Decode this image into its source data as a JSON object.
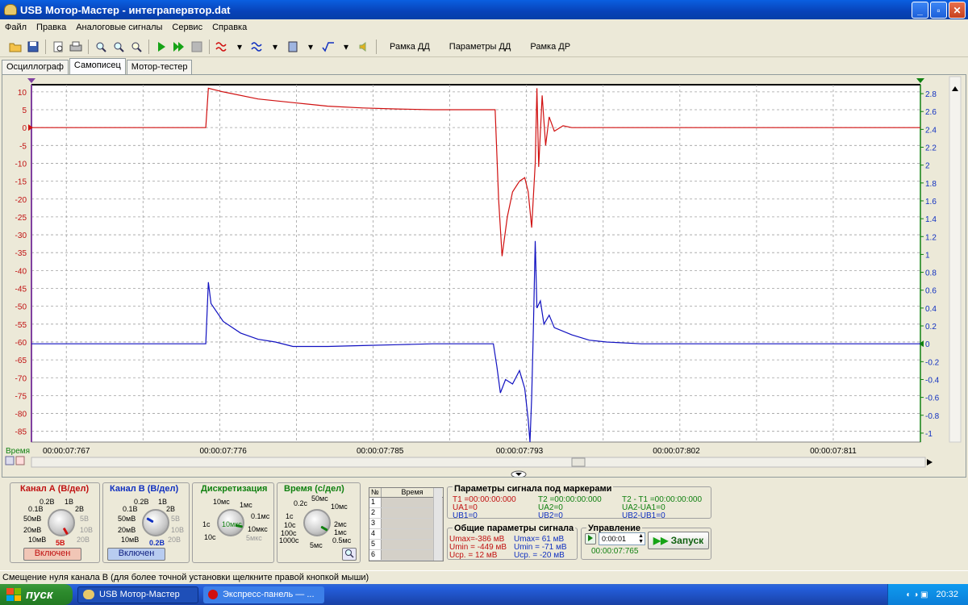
{
  "window": {
    "title": "USB Мотор-Мастер - интеграпервтор.dat",
    "minimize": "_",
    "maximize": "▫",
    "close": "✕"
  },
  "menu": [
    "Файл",
    "Правка",
    "Аналоговые сигналы",
    "Сервис",
    "Справка"
  ],
  "toolbar": {
    "frame_dd": "Рамка ДД",
    "params_dd": "Параметры ДД",
    "frame_dr": "Рамка ДР"
  },
  "tabs": [
    "Осциллограф",
    "Самописец",
    "Мотор-тестер"
  ],
  "active_tab": "Самописец",
  "chart_data": {
    "type": "line",
    "x_axis_title": "Время",
    "x_tick_labels": [
      "00:00:07:767",
      "00:00:07:776",
      "00:00:07:785",
      "00:00:07:793",
      "00:00:07:802",
      "00:00:07:811"
    ],
    "x_range_ms": [
      7765,
      7816
    ],
    "left_ylim": [
      -88,
      12
    ],
    "left_ticks": [
      10,
      5,
      0,
      -5,
      -10,
      -15,
      -20,
      -25,
      -30,
      -35,
      -40,
      -45,
      -50,
      -55,
      -60,
      -65,
      -70,
      -75,
      -80,
      -85
    ],
    "right_ylim": [
      -1.1,
      2.9
    ],
    "right_ticks": [
      2.8,
      2.6,
      2.4,
      2.2,
      2,
      1.8,
      1.6,
      1.4,
      1.2,
      1,
      0.8,
      0.6,
      0.4,
      0.2,
      0,
      -0.2,
      -0.4,
      -0.6,
      -0.8,
      -1
    ],
    "grid": true,
    "series": [
      {
        "channel": "A",
        "color": "#d01010",
        "axis": "left",
        "x": [
          7765,
          7775,
          7775.15,
          7776,
          7778,
          7780,
          7782,
          7784,
          7786,
          7788,
          7790,
          7791.6,
          7791.8,
          7792.0,
          7792.3,
          7792.6,
          7793.0,
          7793.3,
          7793.5,
          7793.7,
          7793.9,
          7794.0,
          7794.1,
          7794.3,
          7794.5,
          7794.7,
          7795.0,
          7795.5,
          7796,
          7800,
          7805,
          7810,
          7816
        ],
        "y": [
          0,
          0,
          11,
          10,
          8,
          7,
          6,
          5.5,
          5.2,
          5,
          5,
          5,
          -20,
          -36,
          -25,
          -18,
          -15,
          -14,
          -18,
          -28,
          -10,
          11,
          -11,
          9,
          -5,
          3,
          -1,
          0.5,
          0,
          0,
          0,
          0,
          0
        ]
      },
      {
        "channel": "B",
        "color": "#1010c0",
        "axis": "right",
        "x": [
          7765,
          7775,
          7775.15,
          7775.3,
          7776,
          7777,
          7778,
          7779,
          7780,
          7782,
          7784,
          7786,
          7788,
          7790,
          7791.5,
          7791.7,
          7791.9,
          7792.2,
          7792.6,
          7793.0,
          7793.3,
          7793.5,
          7793.6,
          7793.7,
          7793.8,
          7793.9,
          7794.0,
          7794.2,
          7794.4,
          7794.7,
          7795,
          7796,
          7797,
          7798,
          7800,
          7805,
          7810,
          7816
        ],
        "y": [
          0,
          0,
          0.69,
          0.45,
          0.25,
          0.12,
          0.05,
          0.02,
          -0.03,
          -0.03,
          -0.02,
          -0.01,
          0,
          0,
          0,
          -0.25,
          -0.55,
          -0.4,
          -0.45,
          -0.3,
          -0.5,
          -0.85,
          -1.1,
          -0.6,
          0.2,
          1.15,
          0.4,
          0.48,
          0.22,
          0.32,
          0.18,
          0.1,
          0.04,
          0.02,
          0,
          0,
          0,
          0
        ]
      }
    ]
  },
  "controls": {
    "channel_a": {
      "title": "Канал А (В/дел)",
      "scales": [
        "0.2В",
        "1В",
        "0.1В",
        "2В",
        "50мВ",
        "5В",
        "20мВ",
        "10В",
        "10мВ",
        "20В",
        "5В"
      ],
      "state": "Включен",
      "color": "#d01010"
    },
    "channel_b": {
      "title": "Канал В (В/дел)",
      "scales": [
        "0.2В",
        "1В",
        "0.1В",
        "2В",
        "50мВ",
        "5В",
        "20мВ",
        "10В",
        "10мВ",
        "20В",
        "0.2В"
      ],
      "state": "Включен",
      "color": "#1030c0"
    },
    "sampling": {
      "title": "Дискретизация",
      "scales": [
        "10мс",
        "1мс",
        "0.1мс",
        "1с",
        "10мкс",
        "10с",
        "5мкс"
      ],
      "knob_label": "10мкс"
    },
    "time": {
      "title": "Время (с/дел)",
      "scales": [
        "50мс",
        "0.2с",
        "10мс",
        "1с",
        "2мс",
        "10с",
        "1мс",
        "100с",
        "0.5мс",
        "1000с",
        "5мс"
      ]
    },
    "markers_table": {
      "header": [
        "№",
        "Время"
      ],
      "rows": [
        "1",
        "2",
        "3",
        "4",
        "5",
        "6"
      ]
    }
  },
  "marker_params": {
    "title": "Параметры сигнала под маркерами",
    "t1": "T1 =00:00:00:000",
    "ua1": "UА1=0",
    "ub1": "UВ1=0",
    "t2": "T2 =00:00:00:000",
    "ua2": "UА2=0",
    "ub2": "UВ2=0",
    "dt": "T2 - T1 =00:00:00:000",
    "dua": "UА2-UА1=0",
    "dub": "UВ2-UВ1=0"
  },
  "general_params": {
    "title": "Общие параметры сигнала",
    "a": [
      "Umax=-386 мВ",
      "Umin = -449 мВ",
      "Ucp. = 12 мВ"
    ],
    "b": [
      "Umax= 61 мВ",
      "Umin = -71 мВ",
      "Ucp. = -20 мВ"
    ]
  },
  "control": {
    "title": "Управление",
    "interval": "0:00:01",
    "elapsed": "00:00:07:765",
    "start_button": "Запуск"
  },
  "status": "Смещение нуля канала В (для более точной установки щелкните правой кнопкой мыши)",
  "taskbar": {
    "start": "пуск",
    "tasks": [
      "USB Мотор-Мастер",
      "Экспресс-панель — ..."
    ],
    "clock": "20:32"
  }
}
